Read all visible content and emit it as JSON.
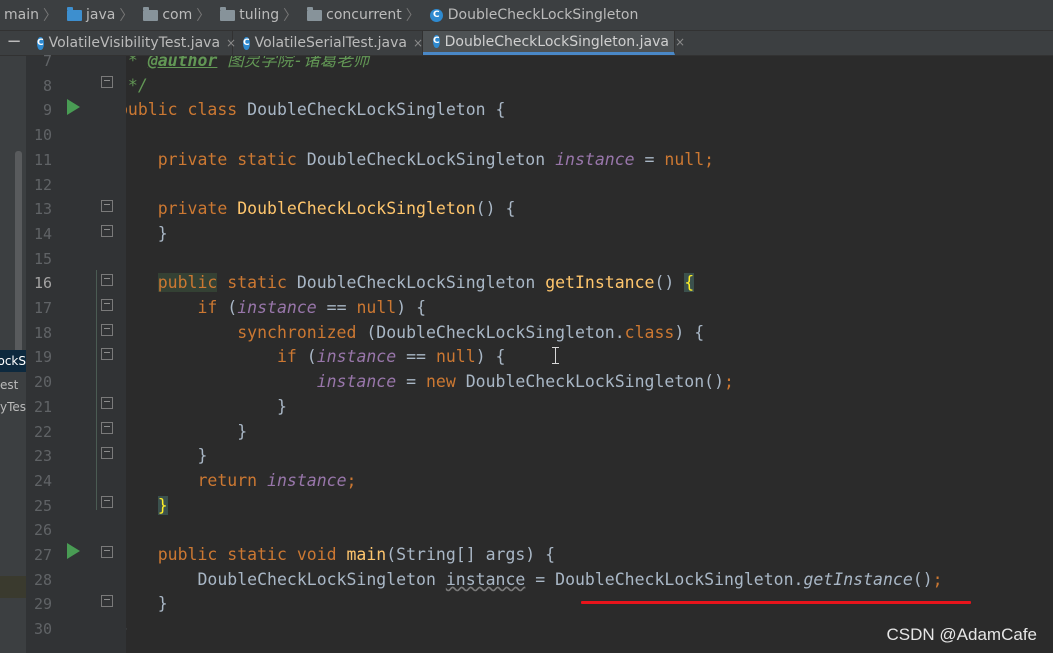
{
  "breadcrumb": {
    "items": [
      "main",
      "java",
      "com",
      "tuling",
      "concurrent",
      "DoubleCheckLockSingleton"
    ]
  },
  "tabs": [
    {
      "label": "VolatileVisibilityTest.java",
      "close": "×",
      "active": false
    },
    {
      "label": "VolatileSerialTest.java",
      "close": "×",
      "active": false
    },
    {
      "label": "DoubleCheckLockSingleton.java",
      "close": "×",
      "active": true
    }
  ],
  "toolwindow": {
    "collapse_label": "−",
    "items": [
      "ockS",
      "est",
      "cyTes"
    ]
  },
  "gutter": {
    "line_numbers": [
      "7",
      "8",
      "9",
      "10",
      "11",
      "12",
      "13",
      "14",
      "15",
      "16",
      "17",
      "18",
      "19",
      "20",
      "21",
      "22",
      "23",
      "24",
      "25",
      "26",
      "27",
      "28",
      "29",
      "30"
    ],
    "current_line": "16"
  },
  "code": {
    "l7_tag": "@author",
    "l7_text": " 图灵学院-诸葛老师",
    "l7_star": " * ",
    "l8": " */",
    "l9_a": "public class",
    "l9_b": " DoubleCheckLockSingleton {",
    "l11_kw": "private static",
    "l11_type": " DoubleCheckLockSingleton ",
    "l11_field": "instance",
    "l11_eq": " = ",
    "l11_null": "null",
    "l11_semi": ";",
    "l13_kw": "private",
    "l13_name": "DoubleCheckLockSingleton",
    "l13_rest": "() {",
    "l14": "}",
    "l16_pub": "public",
    "l16_static": " static",
    "l16_type": " DoubleCheckLockSingleton ",
    "l16_name": "getInstance",
    "l16_rest": "() ",
    "l16_brace": "{",
    "l17_if": "if",
    "l17_paren": " (",
    "l17_field": "instance",
    "l17_eq": " == ",
    "l17_null": "null",
    "l17_rest": ") {",
    "l18_kw": "synchronized",
    "l18_rest": " (DoubleCheckLockSingleton.",
    "l18_class": "class",
    "l18_end": ") {",
    "l19_if": "if",
    "l19_paren": " (",
    "l19_field": "instance",
    "l19_eq": " == ",
    "l19_null": "null",
    "l19_rest": ") {",
    "l20_field": "instance",
    "l20_eq": " = ",
    "l20_new": "new",
    "l20_rest": " DoubleCheckLockSingleton()",
    "l20_semi": ";",
    "l21": "}",
    "l22": "}",
    "l23": "}",
    "l24_ret": "return",
    "l24_field": " instance",
    "l24_semi": ";",
    "l25": "}",
    "l27_kw": "public static void",
    "l27_name": " main",
    "l27_rest": "(String[] args) {",
    "l28_type": "DoubleCheckLockSingleton ",
    "l28_var": "instance",
    "l28_eq": " = DoubleCheckLockSingleton.",
    "l28_call": "getInstance",
    "l28_paren": "()",
    "l28_semi": ";",
    "l29": "}",
    "l30": "}"
  },
  "watermark": "CSDN @AdamCafe",
  "colors": {
    "keyword": "#cc7832",
    "method": "#ffc66d",
    "field": "#9876aa",
    "comment": "#629755",
    "annotation_underline": "#e8141b"
  }
}
